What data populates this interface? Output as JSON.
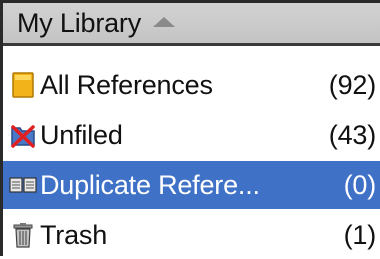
{
  "library": {
    "title": "My Library",
    "sort_indicator": "sort-ascending-arrow-icon"
  },
  "collections": [
    {
      "label": "All References",
      "count": "(92)",
      "icon": "folder-yellow-icon",
      "selected": false
    },
    {
      "label": "Unfiled",
      "count": "(43)",
      "icon": "unfiled-folder-icon",
      "selected": false
    },
    {
      "label": "Duplicate Refere...",
      "count": "(0)",
      "icon": "duplicate-references-icon",
      "selected": true
    },
    {
      "label": "Trash",
      "count": "(1)",
      "icon": "trash-icon",
      "selected": false
    }
  ],
  "colors": {
    "selection": "#3f72c7",
    "header_bg": "#c8c8c8"
  }
}
